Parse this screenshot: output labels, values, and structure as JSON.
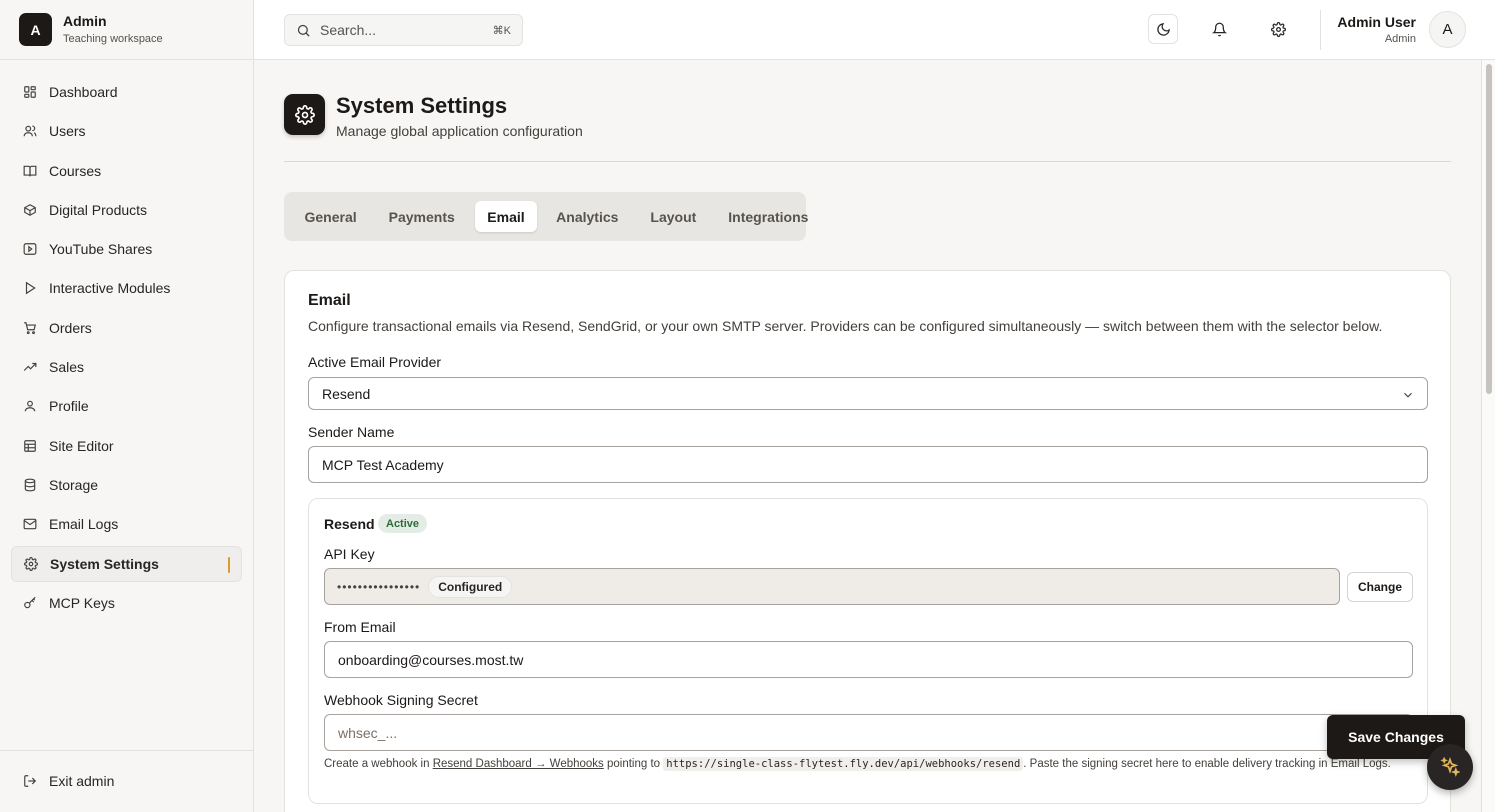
{
  "brand": {
    "logo_letter": "A",
    "name": "Admin",
    "subtitle": "Teaching workspace"
  },
  "sidebar": {
    "items": [
      {
        "label": "Dashboard",
        "icon": "grid-icon"
      },
      {
        "label": "Users",
        "icon": "users-icon"
      },
      {
        "label": "Courses",
        "icon": "book-icon"
      },
      {
        "label": "Digital Products",
        "icon": "package-icon"
      },
      {
        "label": "YouTube Shares",
        "icon": "youtube-icon"
      },
      {
        "label": "Interactive Modules",
        "icon": "play-icon"
      },
      {
        "label": "Orders",
        "icon": "cart-icon"
      },
      {
        "label": "Sales",
        "icon": "trending-up-icon"
      },
      {
        "label": "Profile",
        "icon": "user-icon"
      },
      {
        "label": "Site Editor",
        "icon": "layout-icon"
      },
      {
        "label": "Storage",
        "icon": "database-icon"
      },
      {
        "label": "Email Logs",
        "icon": "mail-icon"
      },
      {
        "label": "System Settings",
        "icon": "gear-icon",
        "active": true
      },
      {
        "label": "MCP Keys",
        "icon": "key-icon"
      }
    ],
    "footer": {
      "label": "Exit admin",
      "icon": "logout-icon"
    }
  },
  "topbar": {
    "search_placeholder": "Search...",
    "search_shortcut": "⌘K",
    "user_name": "Admin User",
    "user_role": "Admin",
    "avatar_letter": "A"
  },
  "page": {
    "title": "System Settings",
    "subtitle": "Manage global application configuration"
  },
  "tabs": [
    {
      "label": "General"
    },
    {
      "label": "Payments"
    },
    {
      "label": "Email",
      "active": true
    },
    {
      "label": "Analytics"
    },
    {
      "label": "Layout"
    },
    {
      "label": "Integrations"
    }
  ],
  "email_card": {
    "title": "Email",
    "description": "Configure transactional emails via Resend, SendGrid, or your own SMTP server. Providers can be configured simultaneously — switch between them with the selector below.",
    "provider_label": "Active Email Provider",
    "provider_value": "Resend",
    "sender_label": "Sender Name",
    "sender_value": "MCP Test Academy",
    "resend": {
      "title": "Resend",
      "badge": "Active",
      "api_key_label": "API Key",
      "api_key_mask": "••••••••••••••••",
      "api_key_status": "Configured",
      "change_label": "Change",
      "from_label": "From Email",
      "from_value": "onboarding@courses.most.tw",
      "webhook_label": "Webhook Signing Secret",
      "webhook_placeholder": "whsec_...",
      "help_prefix": "Create a webhook in ",
      "help_link": "Resend Dashboard → Webhooks",
      "help_middle": " pointing to ",
      "help_url": "https://single-class-flytest.fly.dev/api/webhooks/resend",
      "help_suffix": ". Paste the signing secret here to enable delivery tracking in Email Logs."
    }
  },
  "save_label": "Save Changes",
  "colors": {
    "accent": "#d89b2c",
    "primary": "#1c1917",
    "active_badge_bg": "#e3ede5"
  }
}
